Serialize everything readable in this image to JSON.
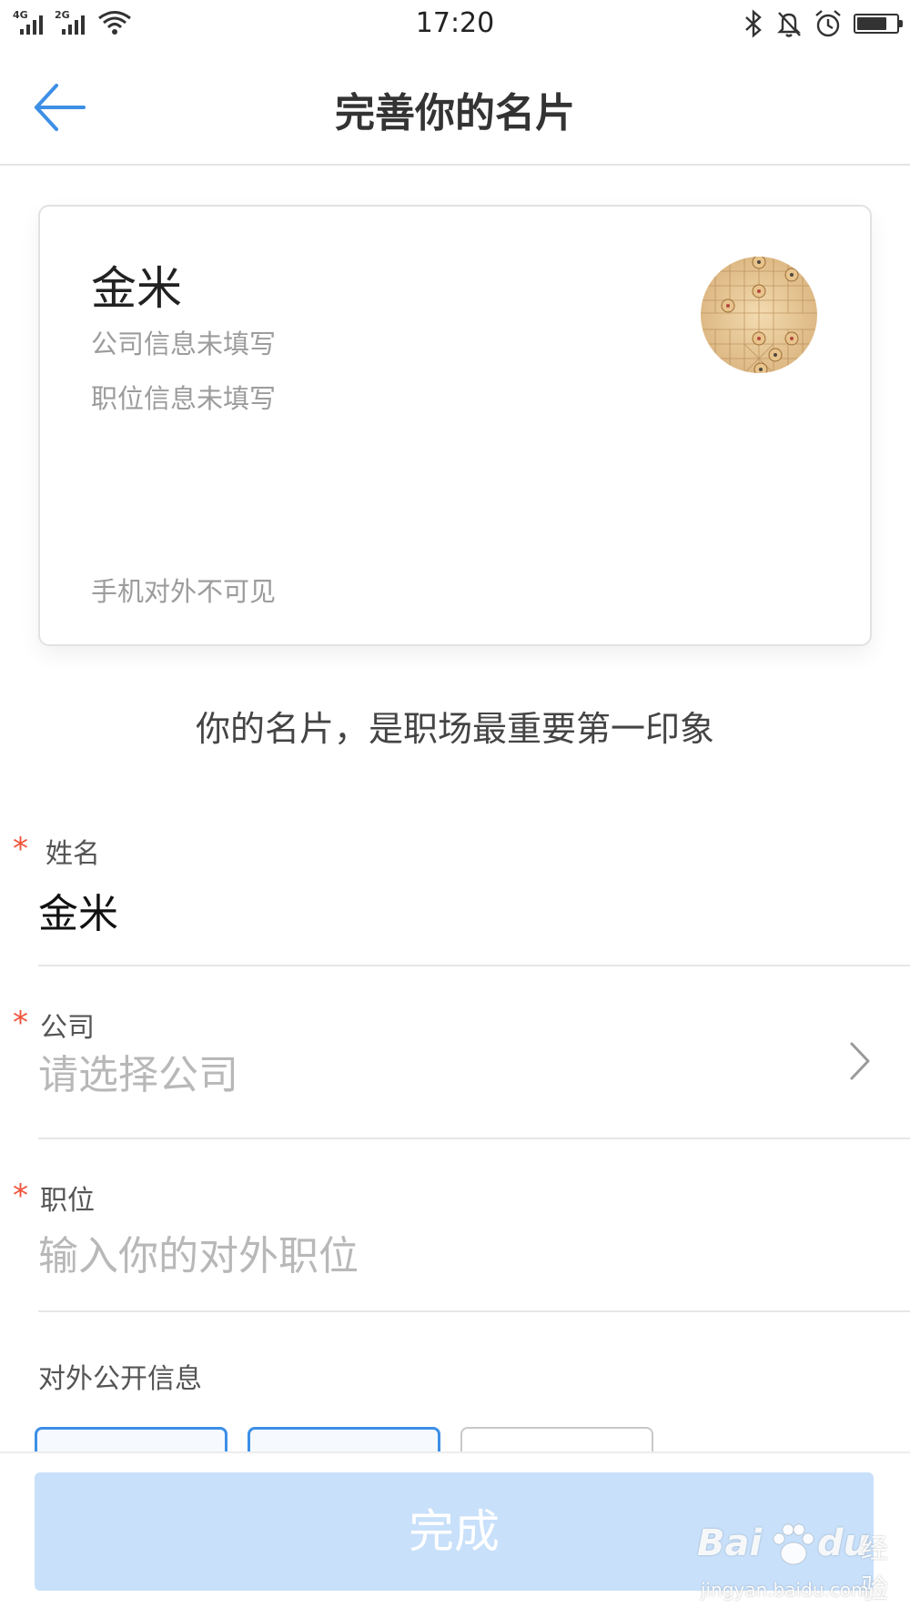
{
  "status_bar": {
    "network_1": "4G",
    "network_2": "2G",
    "time": "17:20",
    "icons": [
      "bluetooth-icon",
      "bell-off-icon",
      "alarm-icon",
      "battery-icon"
    ],
    "battery_level": 0.75
  },
  "nav": {
    "title": "完善你的名片",
    "back_icon": "arrow-left-icon"
  },
  "card": {
    "name": "金米",
    "company": "公司信息未填写",
    "position": "职位信息未填写",
    "phone_note": "手机对外不可见"
  },
  "tagline": "你的名片，是职场最重要第一印象",
  "form": {
    "required_mark": "*",
    "name": {
      "label": "姓名",
      "value": "金米"
    },
    "company": {
      "label": "公司",
      "placeholder": "请选择公司",
      "icon": "chevron-right-icon"
    },
    "position": {
      "label": "职位",
      "placeholder": "输入你的对外职位"
    },
    "public_info": {
      "label": "对外公开信息"
    }
  },
  "done_button": "完成",
  "colors": {
    "accent": "#3d8fe6",
    "required": "#f0533a",
    "button_disabled": "#c8e0fa"
  },
  "watermark": {
    "brand": "Bai",
    "brand_suffix": "du",
    "cn": "经验",
    "url": "jingyan.baidu.com"
  }
}
